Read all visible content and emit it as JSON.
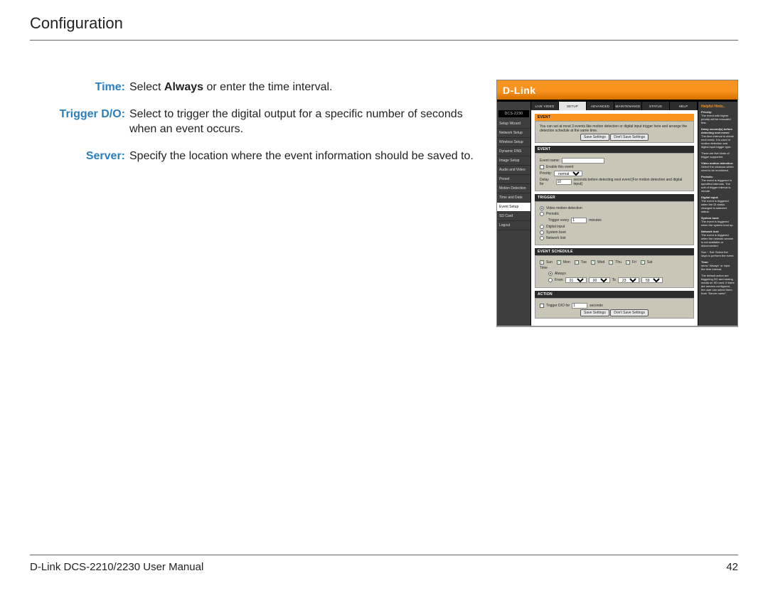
{
  "header": {
    "title": "Configuration"
  },
  "footer": {
    "manual": "D-Link DCS-2210/2230 User Manual",
    "page": "42"
  },
  "definitions": [
    {
      "label": "Time:",
      "text_pre": "Select ",
      "bold": "Always",
      "text_post": " or enter the time interval."
    },
    {
      "label": "Trigger D/O:",
      "text_pre": "Select to trigger the digital output for a specific number of seconds when an event occurs.",
      "bold": "",
      "text_post": ""
    },
    {
      "label": "Server:",
      "text_pre": "Specify the location where the event information should be saved to.",
      "bold": "",
      "text_post": ""
    }
  ],
  "shot": {
    "brand": "D-Link",
    "product": "DCS-2230",
    "tabs": [
      "LIVE VIDEO",
      "SETUP",
      "ADVANCED",
      "MAINTENANCE",
      "STATUS",
      "HELP"
    ],
    "tab_active": 1,
    "sidebar_items": [
      "Setup Wizard",
      "Network Setup",
      "Wireless Setup",
      "Dynamic DNS",
      "Image Setup",
      "Audio and Video",
      "Preset",
      "Motion Detection",
      "Time and Date",
      "Event Setup",
      "SD Card",
      "Logout"
    ],
    "sidebar_active": 9,
    "event": {
      "title": "EVENT",
      "intro": "You can set at most 3 events like motion detection or digital input trigger here and arrange the detection schedule at the same time.",
      "save": "Save Settings",
      "dont": "Don't Save Settings",
      "event_section": "EVENT",
      "name_label": "Event name:",
      "enable_label": "Enable this event",
      "priority_label": "Priority:",
      "priority_value": "normal",
      "delay_pre": "Delay for",
      "delay_value": "10",
      "delay_post": "seconds before detecting next event [For motion detection and digital input]",
      "trigger_section": "TRIGGER",
      "trigger_vmd": "Video motion detection",
      "trigger_periodic": "Periodic",
      "trigger_every_pre": "Trigger every",
      "trigger_every_val": "1",
      "trigger_every_post": "minutes",
      "trigger_di": "Digital input",
      "trigger_sb": "System boot",
      "trigger_nl": "Network lost",
      "schedule_section": "EVENT SCHEDULE",
      "days": [
        "Sun",
        "Mon",
        "Tue",
        "Wed",
        "Thu",
        "Fri",
        "Sat"
      ],
      "time_label": "Time",
      "always": "Always",
      "from": "From",
      "from_h": "01",
      "from_m": "00",
      "to": "To",
      "to_h": "23",
      "to_m": "59",
      "action_section": "ACTION",
      "do_label": "Trigger D/O for",
      "do_val": "1",
      "do_post": "seconds"
    },
    "help": {
      "title": "Helpful Hints..",
      "p1b": "Priority:",
      "p1": "The event with higher priority will be executed first.",
      "p2b": "Delay second(s) before detecting next event:",
      "p2": "The time interval to check next event. It is used in motion detection and digital input trigger type.",
      "p3": "There are five kinds of trigger supported.",
      "p4b": "Video motion detection:",
      "p4": "Select the windows which need to be monitored.",
      "p5b": "Periodic:",
      "p5": "The event is triggered in specified intervals. The unit of trigger interval is minute.",
      "p6b": "Digital input:",
      "p6": "The event is triggered when the DI status changed to selected status.",
      "p7b": "System boot:",
      "p7": "The event is triggered when the system boot up.",
      "p8b": "Network lost:",
      "p8": "The event is triggered when the network service is not available or disconnected.",
      "p9": "Sun ~ Sat: Select the days to perform the event.",
      "p10b": "Time:",
      "p10": "show \"Always\" or input the time interval.",
      "p11": "The default action are triggering DO and storing media on SD card. If there are servers configured, the user can select them from \"Server name\"."
    }
  }
}
